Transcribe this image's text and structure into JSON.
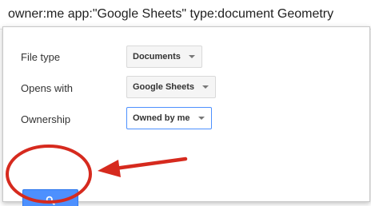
{
  "search": {
    "query": "owner:me app:\"Google Sheets\" type:document Geometry"
  },
  "filters": {
    "file_type": {
      "label": "File type",
      "value": "Documents"
    },
    "opens_with": {
      "label": "Opens with",
      "value": "Google Sheets"
    },
    "ownership": {
      "label": "Ownership",
      "value": "Owned by me"
    }
  },
  "icons": {
    "search_button": "magnifier-icon",
    "dropdown": "caret-down-icon"
  },
  "colors": {
    "button_blue": "#4d90fe",
    "annotation_red": "#d62a1e"
  }
}
